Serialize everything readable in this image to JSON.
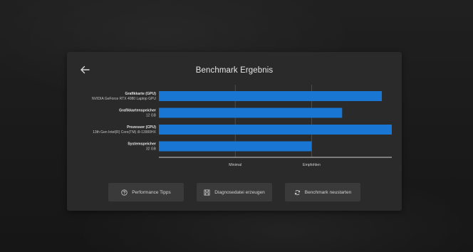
{
  "title": "Benchmark Ergebnis",
  "buttons": {
    "tips": "Performance Tipps",
    "diag": "Diagnosedatei erzeugen",
    "restart": "Benchmark neustarten"
  },
  "colors": {
    "bar": "#1976d2",
    "panel": "#2a2a2a",
    "button": "#3a3a3a"
  },
  "icons": {
    "back": "arrow-left-icon",
    "tips": "help-circle-icon",
    "diag": "save-icon",
    "restart": "refresh-icon"
  },
  "chart_data": {
    "type": "bar",
    "orientation": "horizontal",
    "categories": [
      {
        "label": "Grafikkarte (GPU)",
        "sublabel": "NVIDIA GeForce RTX 4080 Laptop GPU"
      },
      {
        "label": "Grafikkartenspeicher",
        "sublabel": "12 GB"
      },
      {
        "label": "Prozessor (CPU)",
        "sublabel": "13th Gen Intel(R) Core(TM) i9-13900HX"
      },
      {
        "label": "Systemspeicher",
        "sublabel": "32 GB"
      }
    ],
    "values": [
      2.92,
      2.4,
      3.05,
      2.0
    ],
    "xticks": [
      {
        "value": 1,
        "label": "Minimal"
      },
      {
        "value": 2,
        "label": "Empfohlen"
      }
    ],
    "xlim": [
      0,
      3.05
    ],
    "grid": "vertical at ticks"
  }
}
